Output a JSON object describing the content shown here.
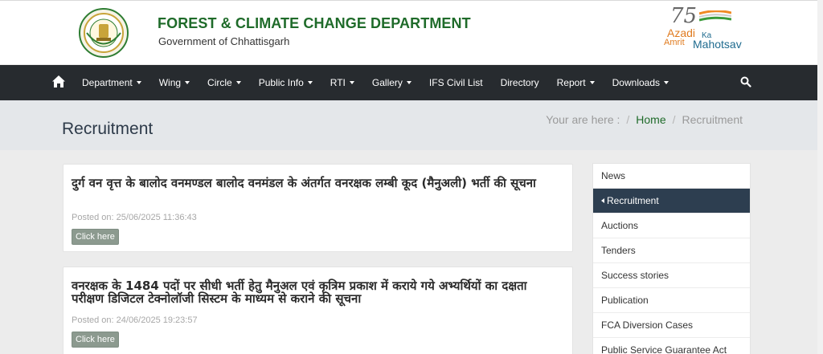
{
  "header": {
    "title": "FOREST & CLIMATE CHANGE DEPARTMENT",
    "subtitle": "Government of Chhattisgarh",
    "azadi": {
      "number": "75",
      "line1": "Azadi",
      "ka": "Ka",
      "amrit": "Amrit",
      "mahotsav": "Mahotsav"
    }
  },
  "nav": {
    "items": [
      {
        "label": "Department",
        "dropdown": true
      },
      {
        "label": "Wing",
        "dropdown": true
      },
      {
        "label": "Circle",
        "dropdown": true
      },
      {
        "label": "Public Info",
        "dropdown": true
      },
      {
        "label": "RTI",
        "dropdown": true
      },
      {
        "label": "Gallery",
        "dropdown": true
      },
      {
        "label": "IFS Civil List",
        "dropdown": false
      },
      {
        "label": "Directory",
        "dropdown": false
      },
      {
        "label": "Report",
        "dropdown": true
      },
      {
        "label": "Downloads",
        "dropdown": true
      }
    ]
  },
  "banner": {
    "page_title": "Recruitment",
    "breadcrumb_prefix": "Your are here :",
    "breadcrumb_sep": "/",
    "breadcrumb_home": "Home",
    "breadcrumb_current": "Recruitment"
  },
  "posts": [
    {
      "title": "दुर्ग वन वृत्त के बालोद वनमण्डल बालोद वनमंडल के अंतर्गत वनरक्षक लम्बी कूद (मैनुअली) भर्ती की सूचना",
      "posted": "Posted on: 25/06/2025 11:36:43",
      "button": "Click here"
    },
    {
      "title": "वनरक्षक के 1484 पदों पर सीधी भर्ती हेतु मैनुअल एवं कृत्रिम प्रकाश में कराये गये अभ्यर्थियों का दक्षता परीक्षण डिजिटल टेक्नोलॉजी सिस्टम के माध्यम से कराने की सूचना",
      "posted": "Posted on: 24/06/2025 19:23:57",
      "button": "Click here"
    }
  ],
  "sidebar": {
    "items": [
      {
        "label": "News"
      },
      {
        "label": "Recruitment",
        "active": true
      },
      {
        "label": "Auctions"
      },
      {
        "label": "Tenders"
      },
      {
        "label": "Success stories"
      },
      {
        "label": "Publication"
      },
      {
        "label": "FCA Diversion Cases"
      },
      {
        "label": "Public Service Guarantee Act"
      }
    ]
  },
  "colors": {
    "brand_green": "#1f6b2a",
    "navbar": "#272b2f",
    "sidebar_active": "#2d3e50",
    "button": "#8c9a8f"
  }
}
